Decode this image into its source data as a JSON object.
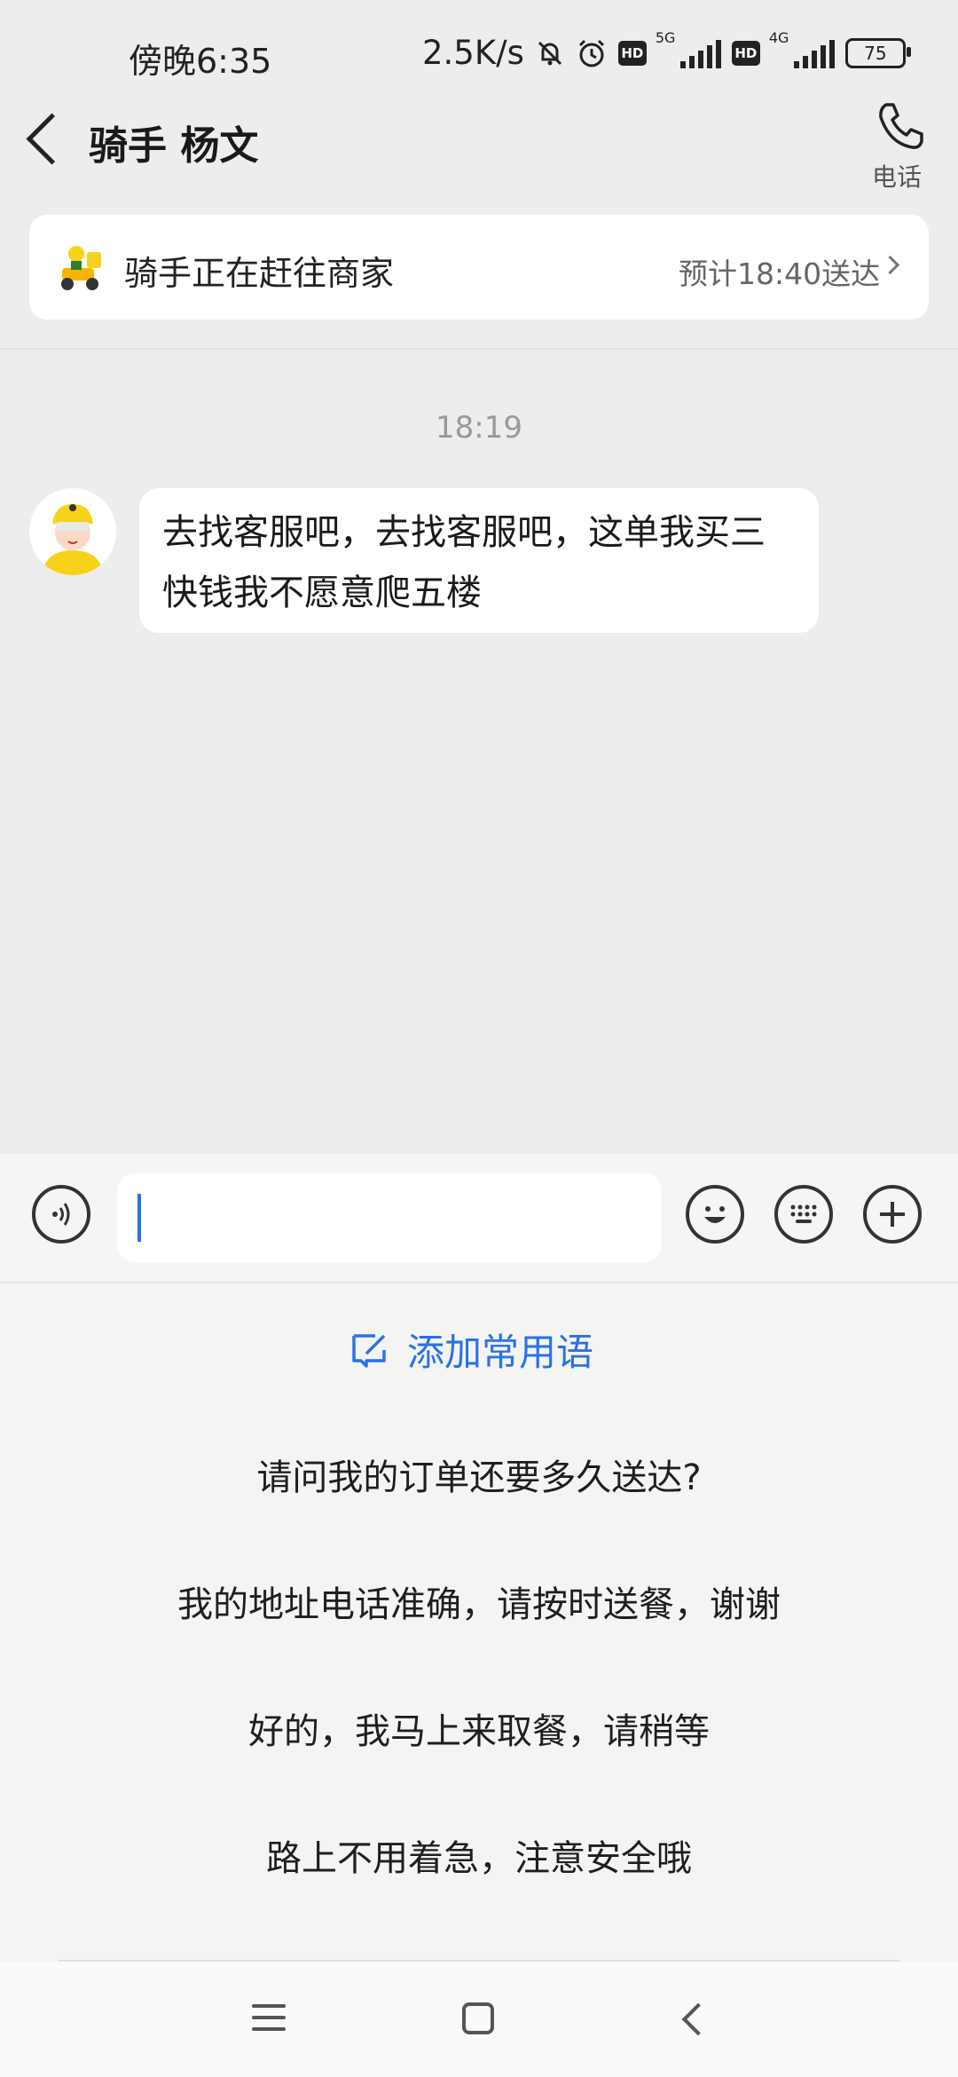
{
  "status_bar": {
    "time": "傍晚6:35",
    "speed": "2.5K/s",
    "net1": "5G",
    "net2": "4G",
    "hd": "HD",
    "battery": "75"
  },
  "header": {
    "title": "骑手 杨文",
    "phone_label": "电话"
  },
  "delivery_card": {
    "status": "骑手正在赶往商家",
    "eta": "预计18:40送达"
  },
  "chat": {
    "timestamp": "18:19",
    "messages": [
      {
        "sender": "rider",
        "text": "去找客服吧，去找客服吧，这单我买三快钱我不愿意爬五楼"
      }
    ]
  },
  "input": {
    "value": "",
    "placeholder": ""
  },
  "quick_replies": {
    "add_label": "添加常用语",
    "items": [
      "请问我的订单还要多久送达?",
      "我的地址电话准确，请按时送餐，谢谢",
      "好的，我马上来取餐，请稍等",
      "路上不用着急，注意安全哦"
    ]
  },
  "colors": {
    "accent": "#2a72e8",
    "background": "#ededed",
    "rider_yellow": "#f7d21b"
  },
  "icons": [
    "back-icon",
    "phone-icon",
    "rider-scooter-icon",
    "chevron-right-icon",
    "voice-icon",
    "emoji-icon",
    "keyboard-icon",
    "plus-icon",
    "edit-icon"
  ]
}
